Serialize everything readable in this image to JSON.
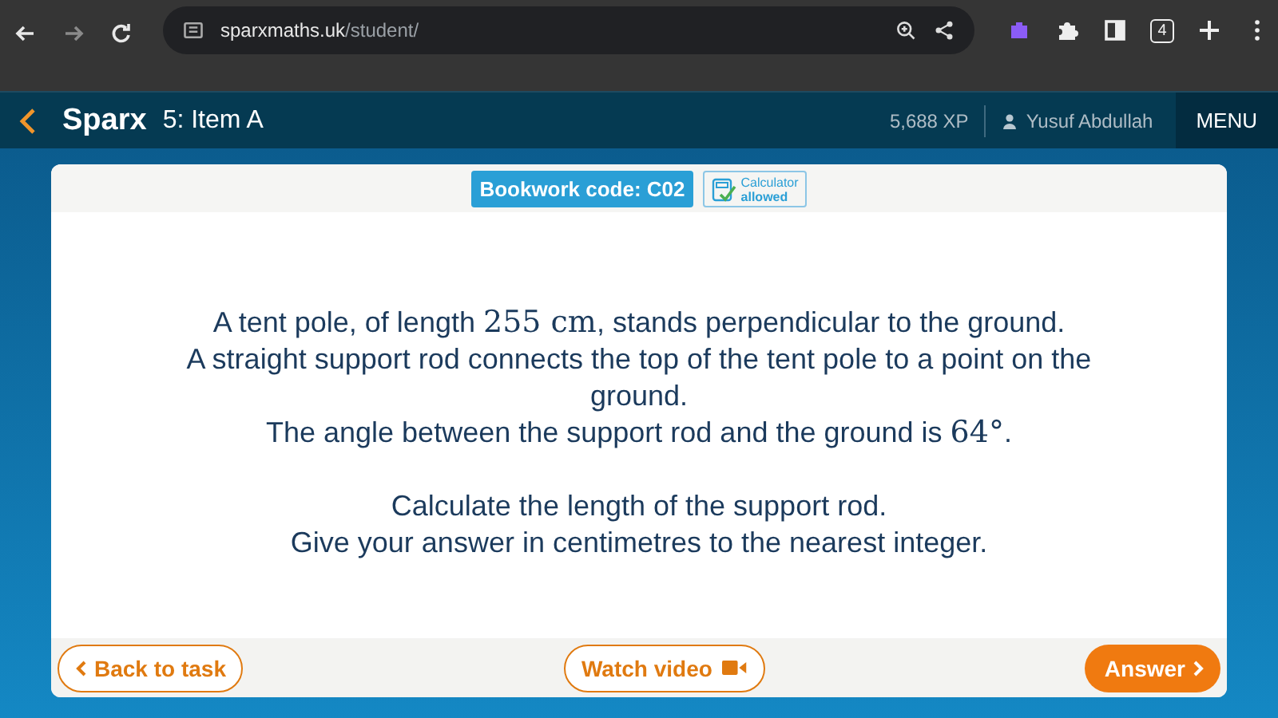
{
  "browser": {
    "url_host": "sparxmaths.uk",
    "url_path": "/student/",
    "tab_count": "4"
  },
  "header": {
    "logo": "Sparx",
    "title": "5: Item A",
    "xp": "5,688 XP",
    "user": "Yusuf Abdullah",
    "menu": "MENU"
  },
  "card": {
    "bookwork_code": "Bookwork code: C02",
    "calculator": {
      "line_1": "Calculator",
      "line_2": "allowed"
    },
    "question": [
      {
        "before": "A tent pole, of length ",
        "math": "255 cm",
        "after": ", stands perpendicular to the ground."
      },
      {
        "before": "A straight support rod connects the top of the tent pole to a point on the ground."
      },
      {
        "before": "The angle between the support rod and the ground is ",
        "math": "64°",
        "after": "."
      }
    ],
    "instructions": [
      "Calculate the length of the support rod.",
      "Give your answer in centimetres to the nearest integer."
    ]
  },
  "footer": {
    "back": "Back to task",
    "video": "Watch video",
    "answer": "Answer"
  }
}
